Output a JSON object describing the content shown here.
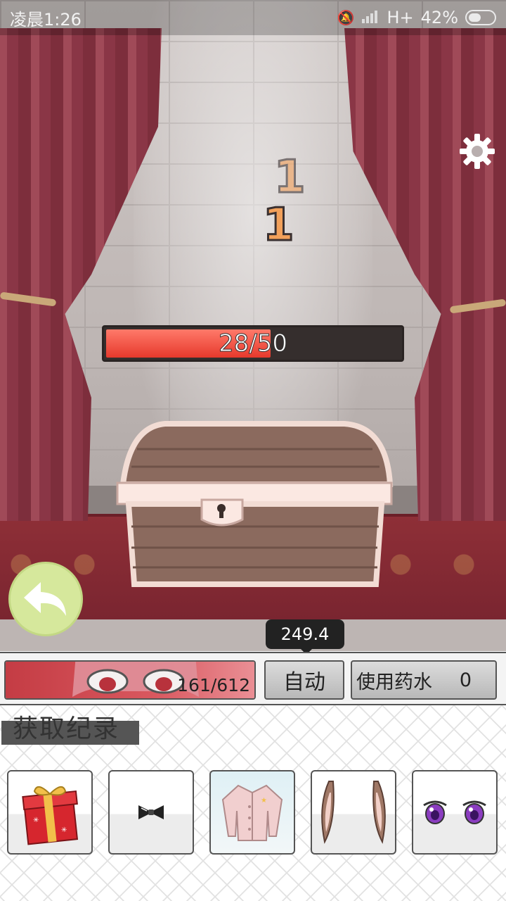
{
  "status_bar": {
    "time": "凌晨1:26",
    "network": "H+",
    "battery": "42%"
  },
  "boss": {
    "hp_current": 28,
    "hp_max": 50,
    "hp_text": "28/50",
    "damage_numbers": [
      "1",
      "1"
    ]
  },
  "timer": "249.4",
  "player": {
    "hp_current": 161,
    "hp_max": 612,
    "hp_text": "161/612"
  },
  "controls": {
    "auto_label": "自动",
    "potion_label": "使用药水",
    "potion_count": "0"
  },
  "records": {
    "title": "获取纪录",
    "items": [
      {
        "icon": "gift-box-icon"
      },
      {
        "icon": "bow-tie-icon"
      },
      {
        "icon": "pink-cardigan-icon"
      },
      {
        "icon": "animal-ears-icon"
      },
      {
        "icon": "purple-eyes-icon"
      }
    ]
  },
  "colors": {
    "boss_hp_fill": "#e6392c",
    "player_hp_fill": "#c43c44",
    "back_button": "#d6e89c",
    "curtain": "#8a3646"
  }
}
